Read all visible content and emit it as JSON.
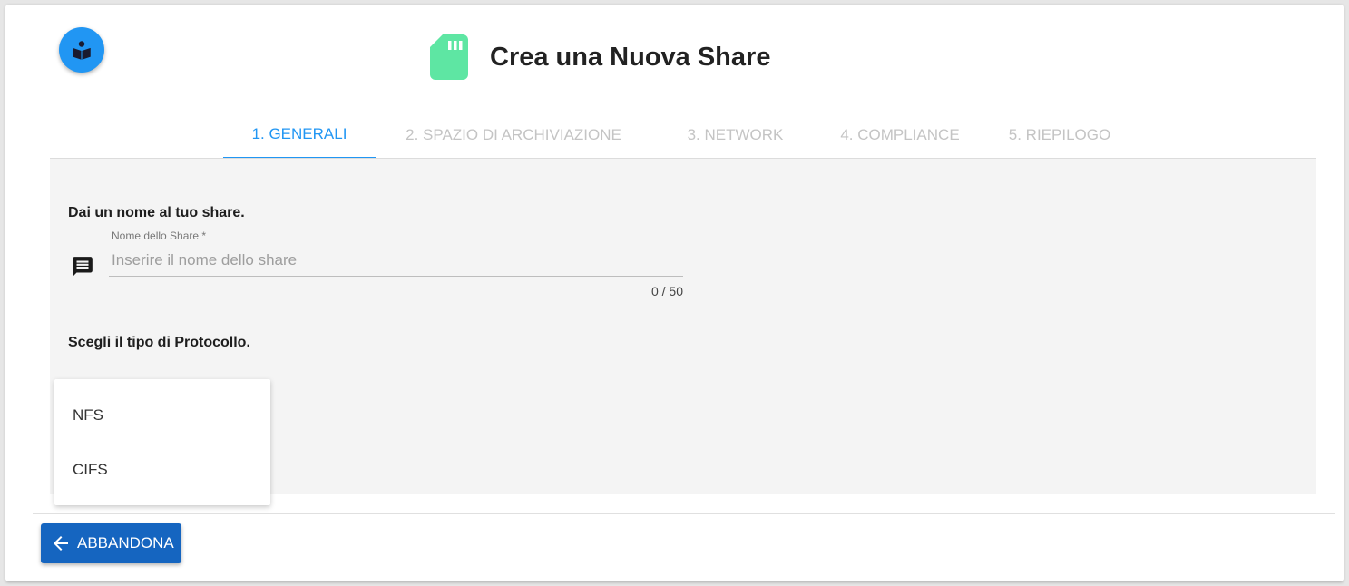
{
  "header": {
    "title": "Crea una Nuova Share",
    "help_icon": "book-reader-icon",
    "title_icon": "sd-card-icon",
    "title_icon_color": "#5ee6a3"
  },
  "tabs": [
    {
      "label": "1. GENERALI",
      "active": true
    },
    {
      "label": "2. SPAZIO DI ARCHIVIAZIONE",
      "active": false
    },
    {
      "label": "3. NETWORK",
      "active": false
    },
    {
      "label": "4. COMPLIANCE",
      "active": false
    },
    {
      "label": "5. RIEPILOGO",
      "active": false
    }
  ],
  "general": {
    "name_section_label": "Dai un nome al tuo share.",
    "name_field": {
      "label": "Nome dello Share *",
      "placeholder": "Inserire il nome dello share",
      "value": "",
      "counter": "0 / 50",
      "icon": "message-icon"
    },
    "protocol_section_label": "Scegli il tipo di Protocollo.",
    "protocol_options": [
      "NFS",
      "CIFS"
    ]
  },
  "footer": {
    "abandon_label": "ABBANDONA",
    "abandon_icon": "arrow-left-icon"
  },
  "colors": {
    "accent": "#2196f3",
    "primary_button": "#1565c0",
    "inactive_tab": "#c4c4c4",
    "content_bg": "#f4f4f4"
  }
}
